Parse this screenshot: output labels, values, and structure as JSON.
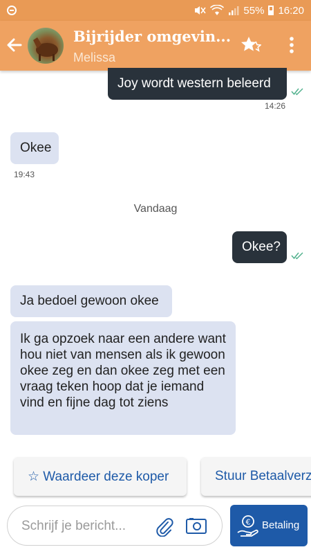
{
  "status_bar": {
    "battery": "55%",
    "time": "16:20"
  },
  "header": {
    "title": "Bijrijder omgevin...",
    "subtitle": "Melissa"
  },
  "messages": [
    {
      "text": "Joy wordt western beleerd",
      "time": "14:26"
    },
    {
      "text": "Okee",
      "time": "19:43"
    },
    {
      "text": "Okee?"
    },
    {
      "text": "Ja bedoel gewoon okee"
    },
    {
      "text": "Ik ga opzoek naar een andere want hou niet van mensen als ik gewoon okee zeg en dan okee zeg met een vraag teken hoop dat je iemand vind en fijne dag tot ziens"
    }
  ],
  "date_separator": "Vandaag",
  "actions": {
    "rate_label": "☆ Waardeer deze koper",
    "payment_request_label": "Stuur Betaalverz"
  },
  "composer": {
    "placeholder": "Schrijf je bericht..."
  },
  "pay_button": {
    "label": "Betaling"
  },
  "colors": {
    "header": "#EFA261",
    "outgoing": "#29323B",
    "incoming": "#DCE2F1",
    "accent": "#1E5AA8",
    "read_tick": "#4CAF8A"
  }
}
